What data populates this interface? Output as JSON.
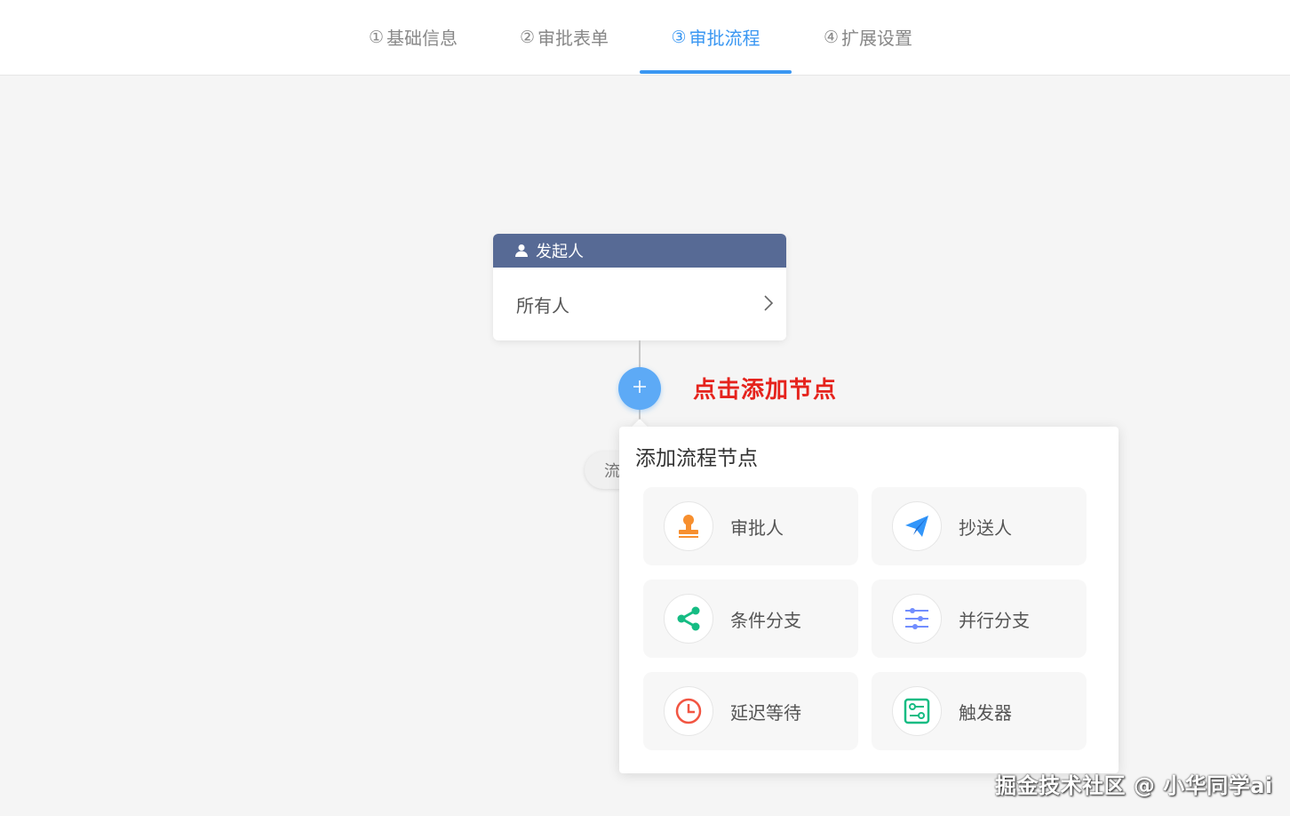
{
  "tabs": [
    {
      "num": "①",
      "label": "基础信息",
      "active": false
    },
    {
      "num": "②",
      "label": "审批表单",
      "active": false
    },
    {
      "num": "③",
      "label": "审批流程",
      "active": true
    },
    {
      "num": "④",
      "label": "扩展设置",
      "active": false
    }
  ],
  "start_node": {
    "header": "发起人",
    "body": "所有人",
    "header_color": "#576a95"
  },
  "annotation": "点击添加节点",
  "end_pill": "流",
  "popover": {
    "title": "添加流程节点",
    "options": [
      {
        "label": "审批人",
        "icon": "stamp-icon",
        "color": "#f78f2e"
      },
      {
        "label": "抄送人",
        "icon": "paper-plane-icon",
        "color": "#3296fa"
      },
      {
        "label": "条件分支",
        "icon": "share-icon",
        "color": "#15bc83"
      },
      {
        "label": "并行分支",
        "icon": "sliders-icon",
        "color": "#718dff"
      },
      {
        "label": "延迟等待",
        "icon": "clock-icon",
        "color": "#f25643"
      },
      {
        "label": "触发器",
        "icon": "trigger-icon",
        "color": "#15bc83"
      }
    ]
  },
  "watermark": "掘金技术社区 @ 小华同学ai",
  "accent": "#3a97f2"
}
